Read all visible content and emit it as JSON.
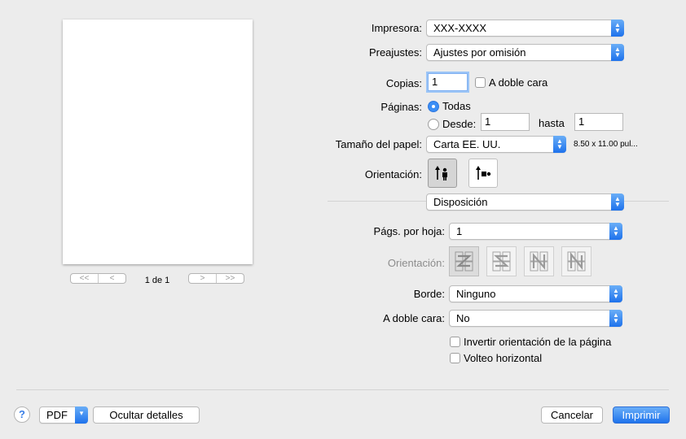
{
  "preview": {
    "page_indicator": "1 de 1",
    "nav_first": "<<",
    "nav_prev": "<",
    "nav_next": ">",
    "nav_last": ">>"
  },
  "printer": {
    "label": "Impresora:",
    "value": "XXX-XXXX"
  },
  "presets": {
    "label": "Preajustes:",
    "value": "Ajustes por omisión"
  },
  "copies": {
    "label": "Copias:",
    "value": "1",
    "duplex_label": "A doble cara",
    "duplex_checked": false
  },
  "pages": {
    "label": "Páginas:",
    "all_label": "Todas",
    "from_label": "Desde:",
    "from_value": "1",
    "to_label": "hasta",
    "to_value": "1",
    "selected": "all"
  },
  "paper_size": {
    "label": "Tamaño del papel:",
    "value": "Carta EE. UU.",
    "dimensions": "8.50 x 11.00 pul..."
  },
  "orientation": {
    "label": "Orientación:",
    "selected": "portrait"
  },
  "section_popup": {
    "value": "Disposición"
  },
  "layout": {
    "pages_per_sheet_label": "Págs. por hoja:",
    "pages_per_sheet_value": "1",
    "direction_label": "Orientación:",
    "border_label": "Borde:",
    "border_value": "Ninguno",
    "two_sided_label": "A doble cara:",
    "two_sided_value": "No",
    "reverse_label": "Invertir orientación de la página",
    "reverse_checked": false,
    "flip_label": "Volteo horizontal",
    "flip_checked": false
  },
  "footer": {
    "help": "?",
    "pdf": "PDF",
    "hide_details": "Ocultar detalles",
    "cancel": "Cancelar",
    "print": "Imprimir"
  },
  "colors": {
    "accent": "#1f73ec",
    "background": "#ececec"
  }
}
